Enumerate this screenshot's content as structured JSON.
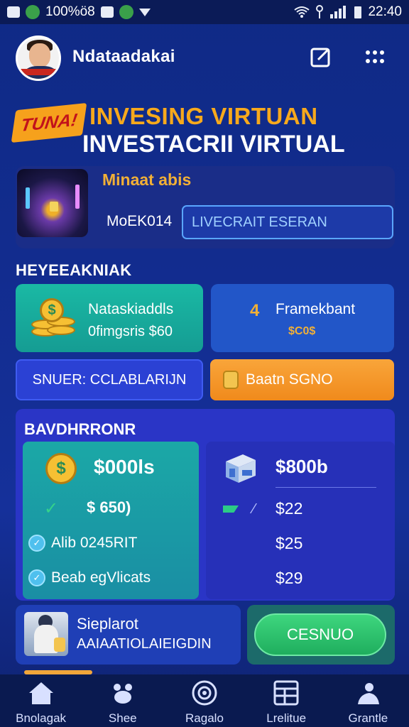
{
  "status_bar": {
    "left_text": "100%ö8",
    "time": "22:40"
  },
  "header": {
    "username": "Ndataadakai"
  },
  "title": {
    "badge": "TUNA!",
    "line1": "INVESING VIRTUAN",
    "line2": "INVESTACRII VIRTUAL"
  },
  "hero": {
    "subtitle": "Minaat abis",
    "code": "MoEK014",
    "input_value": "LIVECRAIT ESERAN"
  },
  "section_label": "HEYEEAKNIAK",
  "tiles": {
    "green": {
      "line1": "Nataskiaddls",
      "line2": "0fimgsris $60"
    },
    "blue": {
      "icon_text": "4",
      "line1": "Framekbant",
      "line2": "$C0$"
    }
  },
  "buttons": {
    "blue": "SNUER: CCLABLARIJN",
    "orange": "Baatn SGNO"
  },
  "balance": {
    "title": "BAVDHRRONR",
    "main_amount": "$000ls",
    "sub_amount": "$ 650)",
    "item1": "Alib 0245RIT",
    "item2": "Beab egVlicats",
    "right_amount": "$800b",
    "right_values": [
      "$22",
      "$25",
      "$29"
    ]
  },
  "promo": {
    "line1": "Sieplarot",
    "line2": "AAIAATIOLAIEIGDIN"
  },
  "cta": "CESNUO",
  "nav": [
    {
      "label": "Bnolagak",
      "icon": "home-icon"
    },
    {
      "label": "Shee",
      "icon": "paw-icon"
    },
    {
      "label": "Ragalo",
      "icon": "target-icon"
    },
    {
      "label": "Lrelitue",
      "icon": "grid-icon"
    },
    {
      "label": "Grantle",
      "icon": "person-icon"
    }
  ],
  "colors": {
    "accent_orange": "#f7a91c",
    "green": "#1ab9a4",
    "panel_blue": "#2a35c6",
    "cta_green": "#1fae5e"
  }
}
